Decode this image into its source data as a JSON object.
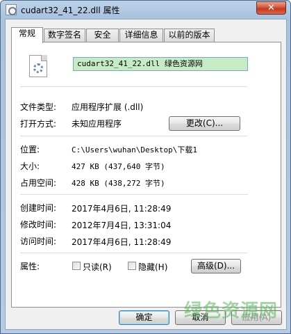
{
  "window": {
    "title": "cudart32_41_22.dll 属性",
    "close_glyph": "✕"
  },
  "tabs": [
    {
      "label": "常规",
      "active": true
    },
    {
      "label": "数字签名",
      "active": false
    },
    {
      "label": "安全",
      "active": false
    },
    {
      "label": "详细信息",
      "active": false
    },
    {
      "label": "以前的版本",
      "active": false
    }
  ],
  "general": {
    "file_name": "cudart32_41_22.dll  绿色资源网",
    "file_type_label": "文件类型:",
    "file_type_value": "应用程序扩展 (.dll)",
    "open_with_label": "打开方式:",
    "open_with_value": "未知应用程序",
    "change_button": "更改(C)...",
    "location_label": "位置:",
    "location_value": "C:\\Users\\wuhan\\Desktop\\下载1",
    "size_label": "大小:",
    "size_value": "427 KB (437,640 字节)",
    "size_on_disk_label": "占用空间:",
    "size_on_disk_value": "428 KB (438,272 字节)",
    "created_label": "创建时间:",
    "created_value": "2017年4月6日, 11:28:49",
    "modified_label": "修改时间:",
    "modified_value": "2012年7月4日, 13:31:04",
    "accessed_label": "访问时间:",
    "accessed_value": "2017年4月6日, 11:28:49",
    "attributes_label": "属性:",
    "readonly_label": "只读(R)",
    "readonly_checked": false,
    "hidden_label": "隐藏(H)",
    "hidden_checked": false,
    "advanced_button": "高级(D)..."
  },
  "footer": {
    "ok": "确定",
    "cancel": "取消",
    "apply": "应用(A)"
  },
  "watermark": {
    "text": "绿色资源网",
    "color": "#5bb35a"
  }
}
